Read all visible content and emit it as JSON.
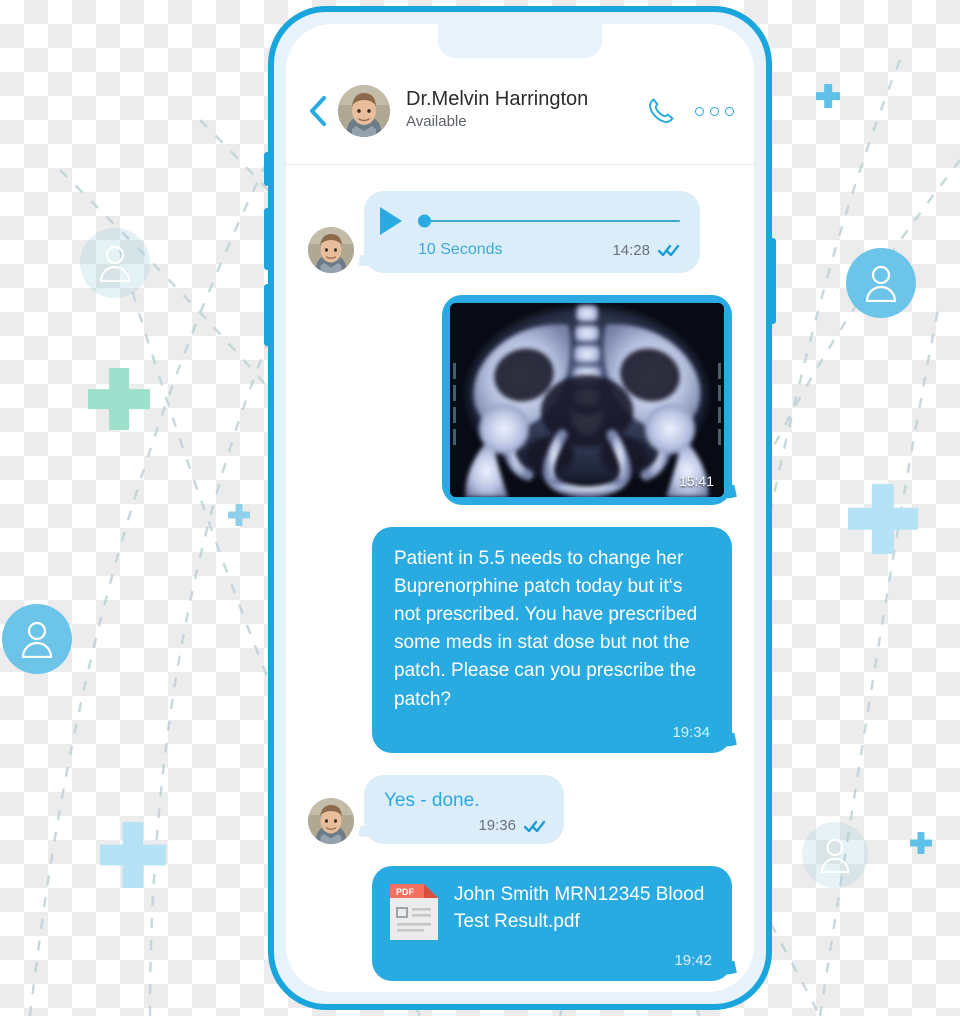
{
  "theme": {
    "accent_blue": "#29abe2",
    "phone_border": "#1ba5dd",
    "incoming_bubble": "#dcedfa",
    "outgoing_bubble": "#29abe2",
    "incoming_text": "#2aa8e0",
    "pdf_red": "#f4705e",
    "deco_green": "#9fe0cd",
    "deco_light_blue": "#b5e2f5"
  },
  "header": {
    "back_icon": "chevron-left-icon",
    "avatar": "doctor-avatar",
    "name": "Dr.Melvin Harrington",
    "status": "Available",
    "call_icon": "phone-call-icon",
    "more_icon": "more-options-icon"
  },
  "messages": [
    {
      "id": "audio",
      "direction": "incoming",
      "type": "audio",
      "play_icon": "play-icon",
      "duration_label": "10 Seconds",
      "time": "14:28",
      "read_icon": "double-check-icon",
      "progress_percent": 0
    },
    {
      "id": "xray",
      "direction": "outgoing",
      "type": "image",
      "image_name": "pelvis-xray-image",
      "time": "15:41"
    },
    {
      "id": "request",
      "direction": "outgoing",
      "type": "text",
      "text": "Patient in 5.5 needs to change her Buprenorphine patch today but it‘s not prescribed. You have prescribed some meds in stat dose but not the patch. Please can you prescribe the patch?",
      "time": "19:34"
    },
    {
      "id": "reply",
      "direction": "incoming",
      "type": "text",
      "text": "Yes - done.",
      "time": "19:36",
      "read_icon": "double-check-icon"
    },
    {
      "id": "attachment",
      "direction": "outgoing",
      "type": "file",
      "file_icon": "pdf-file-icon",
      "file_icon_label": "PDF",
      "file_name": "John Smith MRN12345 Blood Test Result.pdf",
      "time": "19:42"
    }
  ],
  "decorations": {
    "avatars": [
      {
        "name": "deco-avatar-top-left",
        "style": "faded"
      },
      {
        "name": "deco-avatar-top-right",
        "style": "solid"
      },
      {
        "name": "deco-avatar-bottom-left",
        "style": "solid"
      },
      {
        "name": "deco-avatar-bottom-right",
        "style": "faded"
      }
    ],
    "plus_marks": [
      {
        "name": "deco-plus-green-left",
        "color": "#9fe0cd"
      },
      {
        "name": "deco-plus-small-left",
        "color": "#9cd6ee"
      },
      {
        "name": "deco-plus-big-left-bottom",
        "color": "#b5e2f5"
      },
      {
        "name": "deco-plus-big-right",
        "color": "#b5e2f5"
      },
      {
        "name": "deco-plus-small-top-right",
        "color": "#6ec6ea"
      },
      {
        "name": "deco-plus-small-bottom-right",
        "color": "#6ec6ea"
      }
    ]
  }
}
